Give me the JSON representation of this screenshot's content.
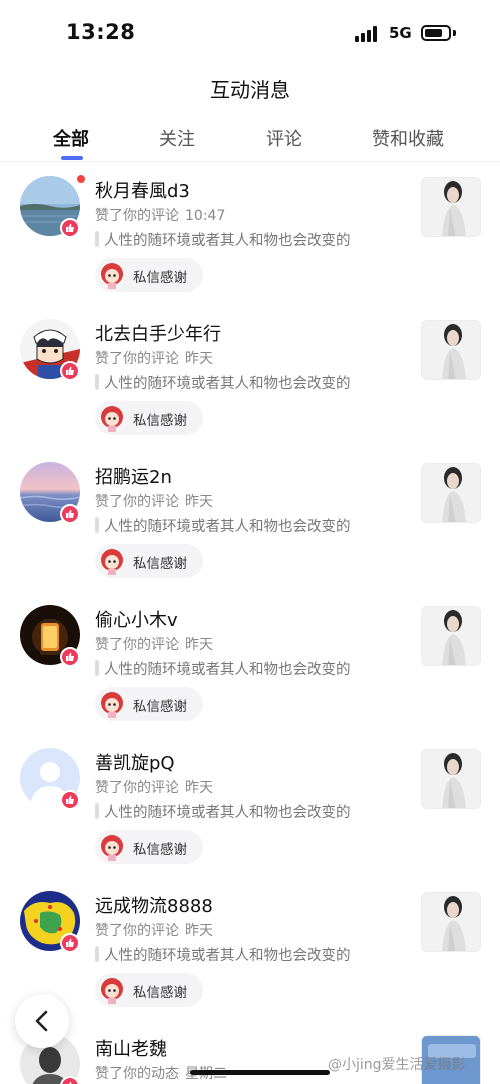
{
  "status_bar": {
    "time": "13:28",
    "network": "5G",
    "battery_level": 0.65
  },
  "header": {
    "title": "互动消息"
  },
  "tabs": [
    {
      "label": "全部",
      "active": true
    },
    {
      "label": "关注",
      "active": false
    },
    {
      "label": "评论",
      "active": false
    },
    {
      "label": "赞和收藏",
      "active": false
    }
  ],
  "feed": {
    "items": [
      {
        "name": "秋月春風d3",
        "action": "赞了你的评论",
        "time": "10:47",
        "quote": "人性的随环境或者其人和物也会改变的",
        "thank_label": "私信感谢",
        "unread": true,
        "avatar": "sky-lake-avatar"
      },
      {
        "name": "北去白手少年行",
        "action": "赞了你的评论",
        "time": "昨天",
        "quote": "人性的随环境或者其人和物也会改变的",
        "thank_label": "私信感谢",
        "unread": false,
        "avatar": "anime-boy-avatar"
      },
      {
        "name": "招鹏运2n",
        "action": "赞了你的评论",
        "time": "昨天",
        "quote": "人性的随环境或者其人和物也会改变的",
        "thank_label": "私信感谢",
        "unread": false,
        "avatar": "sunset-sea-avatar"
      },
      {
        "name": "偷心小木v",
        "action": "赞了你的评论",
        "time": "昨天",
        "quote": "人性的随环境或者其人和物也会改变的",
        "thank_label": "私信感谢",
        "unread": false,
        "avatar": "lantern-avatar"
      },
      {
        "name": "善凯旋pQ",
        "action": "赞了你的评论",
        "time": "昨天",
        "quote": "人性的随环境或者其人和物也会改变的",
        "thank_label": "私信感谢",
        "unread": false,
        "avatar": "default-avatar"
      },
      {
        "name": "远成物流8888",
        "action": "赞了你的评论",
        "time": "昨天",
        "quote": "人性的随环境或者其人和物也会改变的",
        "thank_label": "私信感谢",
        "unread": false,
        "avatar": "map-avatar"
      },
      {
        "name": "南山老魏",
        "action": "赞了你的动态",
        "time": "星期二",
        "quote": "",
        "thank_label": "",
        "unread": false,
        "avatar": "person-avatar"
      }
    ]
  },
  "watermark": "@小jing爱生活爱摄影",
  "colors": {
    "accent": "#4f6ef7",
    "like": "#ee3b5c",
    "unread": "#f1463f"
  }
}
